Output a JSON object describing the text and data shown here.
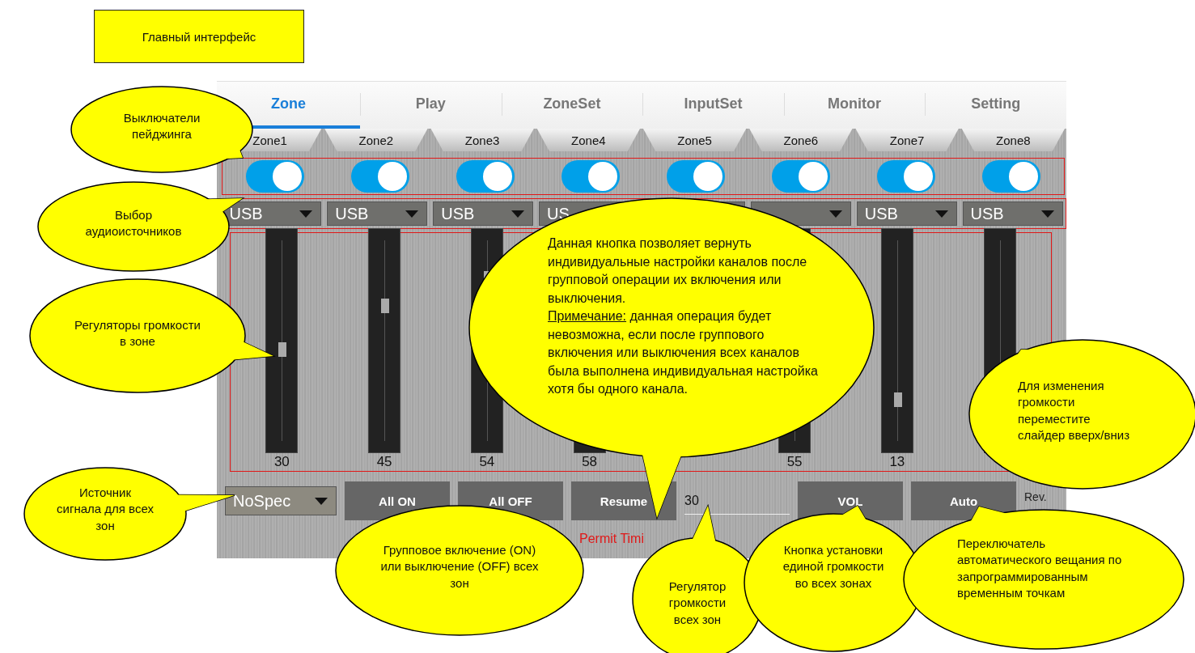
{
  "title_box": {
    "text": "Главный интерфейс"
  },
  "app": {
    "tabs": [
      {
        "label": "Zone",
        "selected": true
      },
      {
        "label": "Play",
        "selected": false
      },
      {
        "label": "ZoneSet",
        "selected": false
      },
      {
        "label": "InputSet",
        "selected": false
      },
      {
        "label": "Monitor",
        "selected": false
      },
      {
        "label": "Setting",
        "selected": false
      }
    ],
    "zones": [
      {
        "label": "Zone1",
        "on": true,
        "source": "USB",
        "level": 0.48,
        "value": "30"
      },
      {
        "label": "Zone2",
        "on": true,
        "source": "USB",
        "level": 0.69,
        "value": "45"
      },
      {
        "label": "Zone3",
        "on": true,
        "source": "USB",
        "level": 0.82,
        "value": "54"
      },
      {
        "label": "Zone4",
        "on": true,
        "source": "US",
        "value": "58"
      },
      {
        "label": "Zone5",
        "on": true
      },
      {
        "label": "Zone6",
        "on": true,
        "value": "55"
      },
      {
        "label": "Zone7",
        "on": true,
        "source": "USB",
        "level": 0.24,
        "value": "13"
      },
      {
        "label": "Zone8",
        "on": true,
        "source": "USB"
      }
    ],
    "source_select": "NoSpec",
    "buttons": [
      "All ON",
      "All OFF",
      "Resume"
    ],
    "volume_field": {
      "value": "30"
    },
    "vol_button": "VOL",
    "auto_button": "Auto",
    "rev_label": "Rev.",
    "permit_label": "Permit Timi"
  },
  "callouts": [
    {
      "kind": "plain",
      "text": "Выключатели пейджинга"
    },
    {
      "kind": "plain",
      "text": "Выбор аудиоисточников"
    },
    {
      "kind": "plain",
      "text": "Регуляторы громкости в зоне"
    },
    {
      "kind": "note",
      "paragraphs": [
        {
          "text": "Данная кнопка позволяет вернуть индивидуальные настройки каналов после групповой операции их включения или выключения."
        },
        {
          "label": "Примечание:",
          "text": " данная операция будет невозможна, если после группового включения или выключения всех каналов была выполнена индивидуальная настройка хотя бы одного канала."
        }
      ]
    },
    {
      "kind": "plain",
      "text": "Для изменения громкости переместите слайдер вверх/вниз"
    },
    {
      "kind": "plain",
      "text": "Источник сигнала для всех зон"
    },
    {
      "kind": "plain",
      "text": "Групповое включение (ON) или выключение (OFF) всех зон"
    },
    {
      "kind": "plain",
      "text": "Регулятор громкости всех зон"
    },
    {
      "kind": "plain",
      "text": "Кнопка установки единой громкости во всех зонах"
    },
    {
      "kind": "plain",
      "text": "Переключатель автоматического вещания по запрограммированным временным точкам"
    }
  ]
}
